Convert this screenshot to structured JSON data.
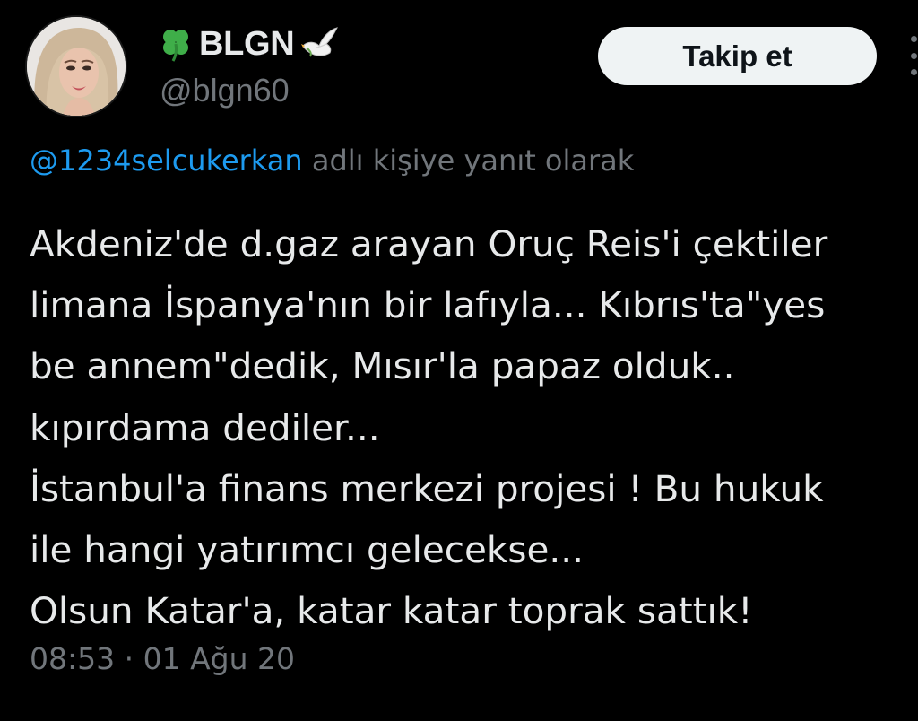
{
  "tweet": {
    "author": {
      "display_name": "BLGN",
      "name_prefix_icon": "four-leaf-clover-icon",
      "name_suffix_icon": "dove-icon",
      "handle": "@blgn60",
      "avatar": "profile-photo"
    },
    "follow_button_label": "Takip et",
    "more_icon": "more-options-icon",
    "reply_to": {
      "mention": "@1234selcukerkan",
      "suffix": "adlı kişiye yanıt olarak"
    },
    "text_lines": [
      "Akdeniz'de d.gaz arayan Oruç Reis'i çektiler",
      "limana İspanya'nın bir lafıyla... Kıbrıs'ta\"yes",
      "be annem\"dedik, Mısır'la papaz olduk..",
      "kıpırdama dediler...",
      "İstanbul'a finans merkezi projesi ! Bu hukuk",
      "ile hangi yatırımcı gelecekse...",
      "Olsun Katar'a, katar katar toprak sattık!"
    ],
    "time": "08:53",
    "separator": "·",
    "date": "01 Ağu 20"
  },
  "colors": {
    "background": "#000000",
    "text_primary": "#e7e9ea",
    "text_secondary": "#71767b",
    "link": "#1d9bf0",
    "button_bg": "#eff3f4",
    "button_text": "#0f1419"
  }
}
